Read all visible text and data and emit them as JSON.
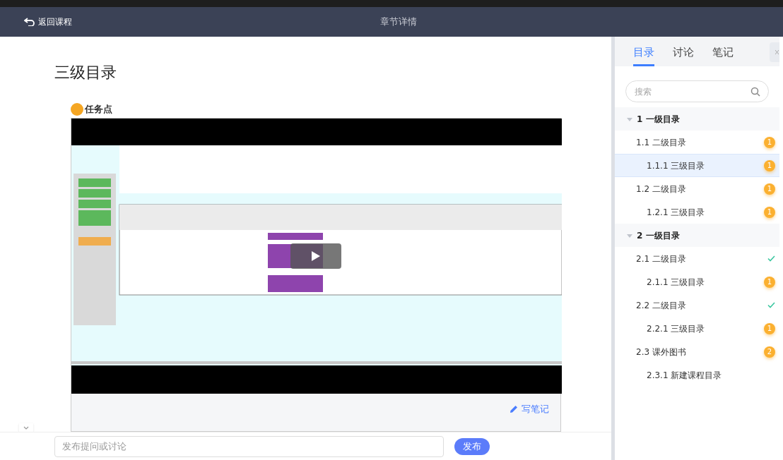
{
  "header": {
    "back": "返回课程",
    "title": "章节详情"
  },
  "main": {
    "title": "三级目录",
    "task_label": "任务点",
    "note_link": "写笔记"
  },
  "composer": {
    "placeholder": "发布提问或讨论",
    "submit": "发布"
  },
  "panel": {
    "tabs": [
      {
        "label": "目录",
        "selected": true
      },
      {
        "label": "讨论",
        "selected": false
      },
      {
        "label": "笔记",
        "selected": false
      }
    ],
    "search": {
      "placeholder": "搜索"
    },
    "tree": [
      {
        "label": "1 一级目录",
        "expanded": true,
        "children": [
          {
            "label": "1.1 二级目录",
            "selected": false,
            "kind": "count",
            "badge": "1",
            "children": [
              {
                "label": "1.1.1 三级目录",
                "selected": true,
                "kind": "count",
                "badge": "1"
              }
            ]
          },
          {
            "label": "1.2 二级目录",
            "selected": false,
            "kind": "count",
            "badge": "1",
            "children": [
              {
                "label": "1.2.1 三级目录",
                "selected": false,
                "kind": "count",
                "badge": "1"
              }
            ]
          }
        ]
      },
      {
        "label": "2 一级目录",
        "expanded": true,
        "children": [
          {
            "label": "2.1 二级目录",
            "selected": false,
            "kind": "done",
            "children": [
              {
                "label": "2.1.1 三级目录",
                "selected": false,
                "kind": "count",
                "badge": "1"
              }
            ]
          },
          {
            "label": "2.2 二级目录",
            "selected": false,
            "kind": "done",
            "children": [
              {
                "label": "2.2.1 三级目录",
                "selected": false,
                "kind": "count",
                "badge": "1"
              }
            ]
          },
          {
            "label": "2.3 课外图书",
            "selected": false,
            "kind": "count",
            "badge": "2",
            "children": [
              {
                "label": "2.3.1 新建课程目录",
                "selected": false
              }
            ]
          }
        ]
      }
    ]
  }
}
